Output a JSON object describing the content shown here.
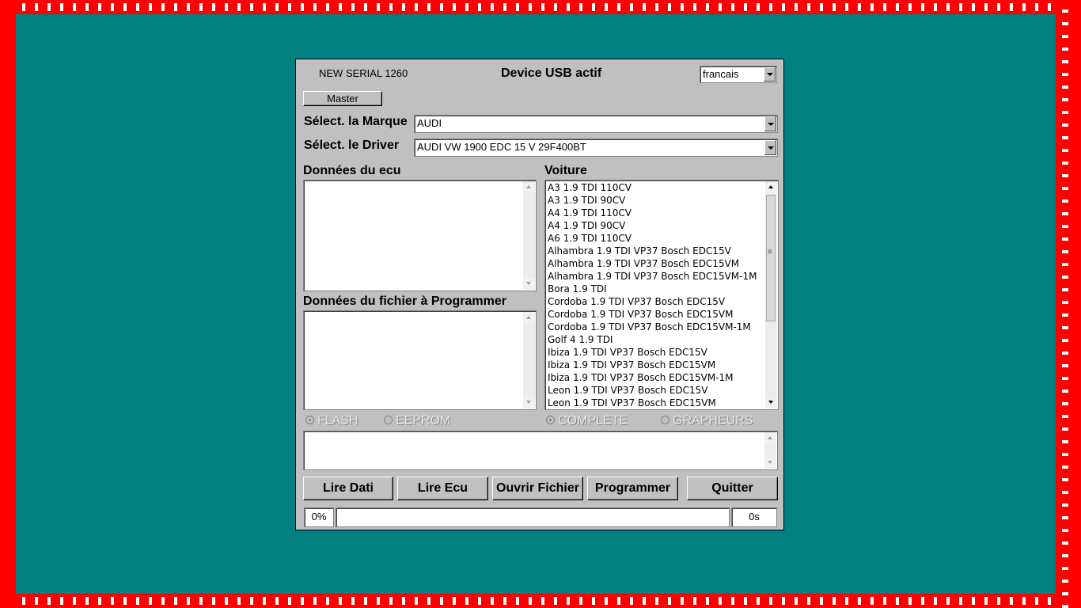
{
  "header": {
    "serial": "NEW SERIAL 1260",
    "device_status": "Device USB actif",
    "language": "francais"
  },
  "master_label": "Master",
  "marque": {
    "label": "Sélect. la Marque",
    "value": "AUDI"
  },
  "driver": {
    "label": "Sélect. le Driver",
    "value": "AUDI VW 1900 EDC 15 V  29F400BT"
  },
  "ecu_label": "Données du ecu",
  "fichier_label": "Données du fichier à Programmer",
  "voiture": {
    "label": "Voiture",
    "items": [
      "A3 1.9 TDI 110CV",
      "A3 1.9 TDI 90CV",
      "A4 1.9 TDI 110CV",
      "A4 1.9 TDI 90CV",
      "A6 1.9 TDI 110CV",
      "Alhambra 1.9 TDI VP37 Bosch EDC15V",
      "Alhambra 1.9 TDI VP37 Bosch EDC15VM",
      "Alhambra 1.9 TDI VP37 Bosch EDC15VM-1M",
      "Bora     1.9 TDI",
      "Cordoba 1.9 TDI VP37 Bosch EDC15V",
      "Cordoba 1.9 TDI VP37 Bosch EDC15VM",
      "Cordoba 1.9 TDI VP37 Bosch EDC15VM-1M",
      "Golf 4   1.9 TDI",
      "Ibiza 1.9 TDI VP37 Bosch EDC15V",
      "Ibiza 1.9 TDI VP37 Bosch EDC15VM",
      "Ibiza 1.9 TDI VP37 Bosch EDC15VM-1M",
      "Leon 1.9 TDI VP37 Bosch EDC15V",
      "Leon 1.9 TDI VP37 Bosch EDC15VM"
    ]
  },
  "options": {
    "flash": "FLASH",
    "eeprom": "EEPROM",
    "complete": "COMPLETE",
    "grapheurs": "GRAPHEURS"
  },
  "buttons": {
    "lire_dati": "Lire Dati",
    "lire_ecu": "Lire Ecu",
    "ouvrir_fichier": "Ouvrir Fichier",
    "programmer": "Programmer",
    "quitter": "Quitter"
  },
  "status": {
    "percent_text": "0%",
    "progress": 0,
    "time": "0s"
  },
  "colors": {
    "desktop": "#008080",
    "frame": "#ff0000",
    "dialog": "#c0c0c0"
  }
}
